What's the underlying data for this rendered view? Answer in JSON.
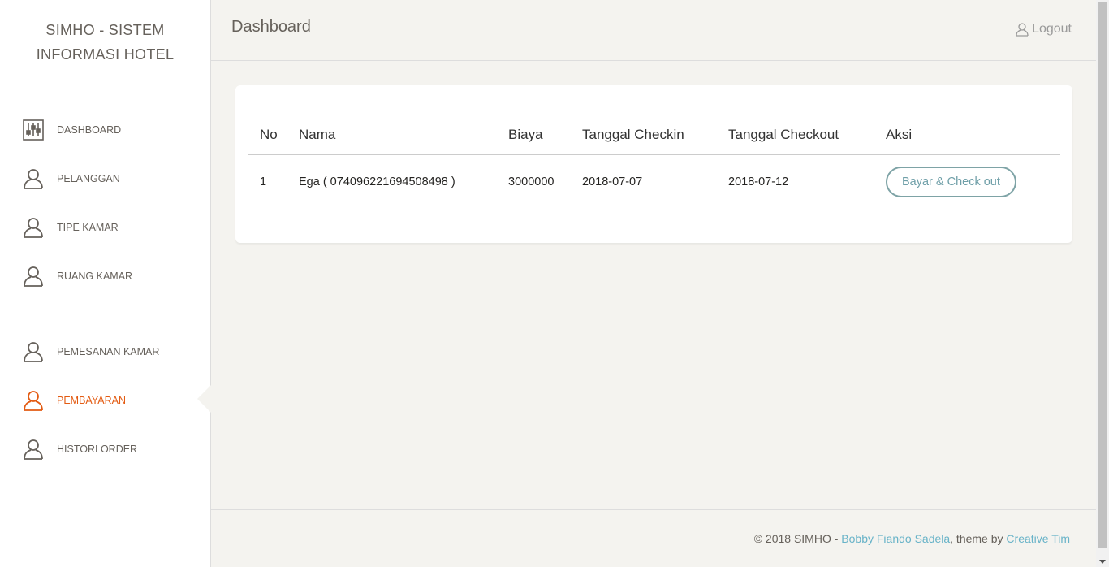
{
  "brand": {
    "line1": "SIMHO - SISTEM",
    "line2": "INFORMASI HOTEL"
  },
  "sidebar": {
    "items": [
      {
        "label": "DASHBOARD",
        "icon": "settings-sliders-icon"
      },
      {
        "label": "PELANGGAN",
        "icon": "user-icon"
      },
      {
        "label": "TIPE KAMAR",
        "icon": "user-icon"
      },
      {
        "label": "RUANG KAMAR",
        "icon": "user-icon"
      },
      {
        "label": "PEMESANAN KAMAR",
        "icon": "user-icon"
      },
      {
        "label": "PEMBAYARAN",
        "icon": "user-icon",
        "active": true
      },
      {
        "label": "HISTORI ORDER",
        "icon": "user-icon"
      }
    ]
  },
  "header": {
    "title": "Dashboard",
    "logout_label": "Logout"
  },
  "table": {
    "columns": [
      "No",
      "Nama",
      "Biaya",
      "Tanggal Checkin",
      "Tanggal Checkout",
      "Aksi"
    ],
    "rows": [
      {
        "no": "1",
        "nama": "Ega ( 074096221694508498 )",
        "biaya": "3000000",
        "checkin": "2018-07-07",
        "checkout": "2018-07-12",
        "action_label": "Bayar & Check out"
      }
    ]
  },
  "footer": {
    "prefix": "© 2018 SIMHO - ",
    "author": "Bobby Fiando Sadela",
    "middle": ", theme by ",
    "theme": "Creative Tim"
  },
  "colors": {
    "accent": "#e35b12",
    "link": "#68b3c8",
    "background": "#f4f3ef"
  }
}
